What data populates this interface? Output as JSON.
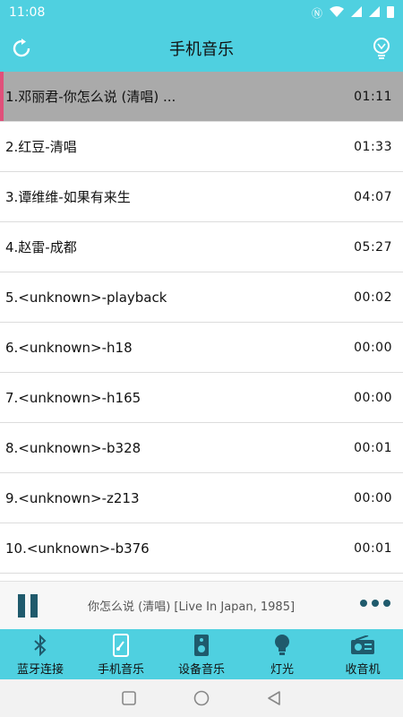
{
  "status": {
    "time": "11:08"
  },
  "header": {
    "title": "手机音乐"
  },
  "songs": [
    {
      "title": "1.邓丽君-你怎么说 (清唱) ...",
      "duration": "01:11"
    },
    {
      "title": "2.红豆-清唱",
      "duration": "01:33"
    },
    {
      "title": "3.谭维维-如果有来生",
      "duration": "04:07"
    },
    {
      "title": "4.赵雷-成都",
      "duration": "05:27"
    },
    {
      "title": "5.<unknown>-playback",
      "duration": "00:02"
    },
    {
      "title": "6.<unknown>-h18",
      "duration": "00:00"
    },
    {
      "title": "7.<unknown>-h165",
      "duration": "00:00"
    },
    {
      "title": "8.<unknown>-b328",
      "duration": "00:01"
    },
    {
      "title": "9.<unknown>-z213",
      "duration": "00:00"
    },
    {
      "title": "10.<unknown>-b376",
      "duration": "00:01"
    }
  ],
  "player": {
    "now_playing": "你怎么说 (清唱) [Live In Japan, 1985]"
  },
  "tabs": [
    {
      "label": "蓝牙连接",
      "icon": "bluetooth-icon"
    },
    {
      "label": "手机音乐",
      "icon": "phone-music-icon"
    },
    {
      "label": "设备音乐",
      "icon": "speaker-icon"
    },
    {
      "label": "灯光",
      "icon": "bulb-icon"
    },
    {
      "label": "收音机",
      "icon": "radio-icon"
    }
  ],
  "colors": {
    "accent": "#4fd0e0",
    "active_row": "#aaaaaa",
    "active_marker": "#e0507a",
    "control": "#1f5a6c"
  }
}
